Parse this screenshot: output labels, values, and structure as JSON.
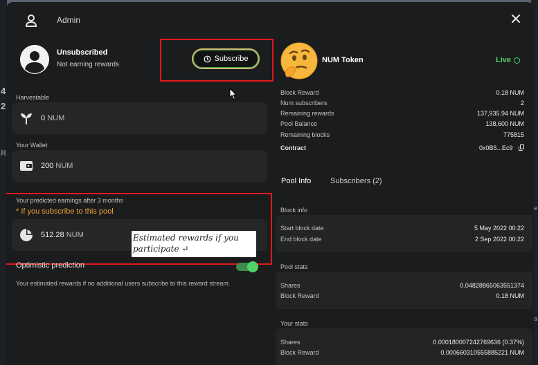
{
  "header": {
    "title": "Admin"
  },
  "status": {
    "title": "Unsubscribed",
    "subtitle": "Not earning rewards"
  },
  "subscribe_button": {
    "label": "Subscribe"
  },
  "harvestable": {
    "label": "Harvestable",
    "value": "0",
    "unit": "NUM"
  },
  "wallet": {
    "label": "Your Wallet",
    "value": "200",
    "unit": "NUM"
  },
  "prediction": {
    "label": "Your predicted earnings after 3 months",
    "warning": "* If you subscribe to this pool",
    "value": "512.28",
    "unit": "NUM"
  },
  "annotation": {
    "text": "Estimated rewards if you participate ↵"
  },
  "optimistic": {
    "label": "Optimistic prediction",
    "enabled": true,
    "description": "Your estimated rewards if no additional users subscribe to this reward stream."
  },
  "token": {
    "name": "NUM Token",
    "status": "Live"
  },
  "token_stats": [
    {
      "key": "Block Reward",
      "value": "0.18 NUM"
    },
    {
      "key": "Num subscribers",
      "value": "2"
    },
    {
      "key": "Remaining rewards",
      "value": "137,935.94 NUM"
    },
    {
      "key": "Pool Balance",
      "value": "138,600 NUM"
    },
    {
      "key": "Remaining blocks",
      "value": "775815"
    }
  ],
  "contract": {
    "key": "Contract",
    "value": "0x0B5...Ec9"
  },
  "tabs": [
    {
      "label": "Pool Info",
      "active": true
    },
    {
      "label": "Subscribers (2)",
      "active": false
    }
  ],
  "block_info": {
    "title": "Block info",
    "rows": [
      {
        "key": "Start block date",
        "value": "5 May 2022 00:22"
      },
      {
        "key": "End block date",
        "value": "2 Sep 2022 00:22"
      }
    ]
  },
  "pool_stats": {
    "title": "Pool stats",
    "rows": [
      {
        "key": "Shares",
        "value": "0.04828865063551374"
      },
      {
        "key": "Block Reward",
        "value": "0.18 NUM"
      }
    ]
  },
  "your_stats": {
    "title": "Your stats",
    "rows": [
      {
        "key": "Shares",
        "value": "0.000180007242769636 (0.37%)"
      },
      {
        "key": "Block Reward",
        "value": "0.000660310555885221 NUM"
      }
    ]
  },
  "background_edge": {
    "left_glyphs": [
      "4",
      "2",
      "R"
    ],
    "right_glyphs": [
      "e",
      "a"
    ]
  },
  "colors": {
    "accent_green": "#4fd366",
    "warning_orange": "#f0a232",
    "highlight_red": "#e0191d",
    "modal_bg": "#1b1c1e"
  }
}
